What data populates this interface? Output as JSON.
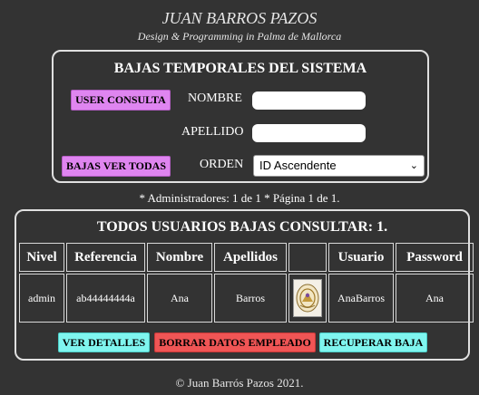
{
  "header": {
    "title": "JUAN BARROS PAZOS",
    "subtitle": "Design & Programming in Palma de Mallorca"
  },
  "search_panel": {
    "title": "BAJAS TEMPORALES DEL SISTEMA",
    "user_consulta_button": "USER CONSULTA",
    "nombre_label": "NOMBRE",
    "nombre_value": "",
    "apellido_label": "APELLIDO",
    "apellido_value": "",
    "bajas_ver_todas_button": "BAJAS VER TODAS",
    "orden_label": "ORDEN",
    "orden_selected": "ID Ascendente"
  },
  "info_line": "* Administradores: 1 de 1 * Página 1 de 1.",
  "results_panel": {
    "title": "TODOS USUARIOS BAJAS CONSULTAR: 1.",
    "columns": [
      "Nivel",
      "Referencia",
      "Nombre",
      "Apellidos",
      "",
      "Usuario",
      "Password"
    ],
    "rows": [
      {
        "nivel": "admin",
        "referencia": "ab44444444a",
        "nombre": "Ana",
        "apellidos": "Barros",
        "photo_icon": "user-photo-icon",
        "usuario": "AnaBarros",
        "password": "Ana"
      }
    ],
    "actions": {
      "ver_detalles": "VER DETALLES",
      "borrar": "BORRAR DATOS EMPLEADO",
      "recuperar": "RECUPERAR BAJA"
    }
  },
  "footer": "© Juan Barrós Pazos 2021.",
  "colors": {
    "background": "#333333",
    "purple_button": "#df85f0",
    "cyan_button": "#7ff5ef",
    "red_button": "#f05555"
  }
}
